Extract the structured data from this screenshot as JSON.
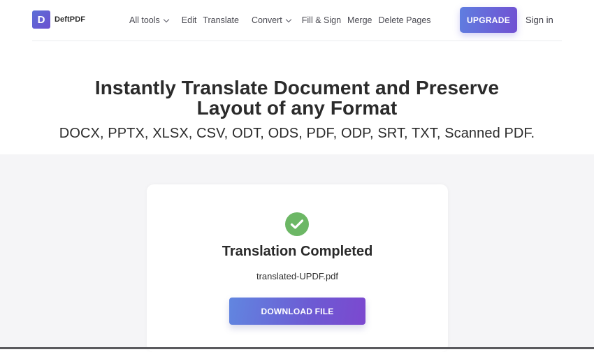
{
  "header": {
    "logo_letter": "D",
    "brand": "DeftPDF",
    "nav": [
      {
        "label": "All tools",
        "dropdown": true
      },
      {
        "label": "Edit",
        "dropdown": false
      },
      {
        "label": "Translate",
        "dropdown": false
      },
      {
        "label": "Convert",
        "dropdown": true
      },
      {
        "label": "Fill & Sign",
        "dropdown": false
      },
      {
        "label": "Merge",
        "dropdown": false
      },
      {
        "label": "Delete Pages",
        "dropdown": false
      }
    ],
    "upgrade_label": "UPGRADE",
    "signin_label": "Sign in"
  },
  "hero": {
    "title_line1": "Instantly Translate Document and Preserve",
    "title_line2": "Layout of any Format",
    "subtitle": "DOCX, PPTX, XLSX, CSV, ODT, ODS, PDF, ODP, SRT, TXT, Scanned PDF."
  },
  "result": {
    "status_icon": "check-circle-icon",
    "title": "Translation Completed",
    "file_name": "translated-UPDF.pdf",
    "download_label": "DOWNLOAD FILE"
  },
  "colors": {
    "brand_gradient_start": "#5f7ee0",
    "brand_gradient_end": "#7150d2",
    "success": "#6cb765",
    "page_bg": "#f5f5f7"
  }
}
